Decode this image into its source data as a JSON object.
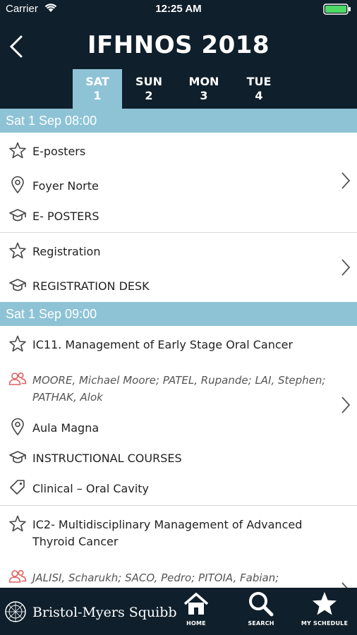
{
  "status": {
    "carrier": "Carrier",
    "time": "12:25 AM"
  },
  "header": {
    "title": "IFHNOS 2018"
  },
  "tabs": [
    {
      "day": "SAT",
      "num": "1",
      "active": true
    },
    {
      "day": "SUN",
      "num": "2",
      "active": false
    },
    {
      "day": "MON",
      "num": "3",
      "active": false
    },
    {
      "day": "TUE",
      "num": "4",
      "active": false
    }
  ],
  "sections": [
    {
      "header": "Sat 1 Sep 08:00",
      "sessions": [
        {
          "title": "E-posters",
          "location": "Foyer Norte",
          "track": "E- POSTERS"
        },
        {
          "title": "Registration",
          "track": "REGISTRATION DESK"
        }
      ]
    },
    {
      "header": "Sat 1 Sep 09:00",
      "sessions": [
        {
          "title": "IC11. Management of Early Stage Oral Cancer",
          "speakers_line1": "MOORE, Michael Moore; PATEL, Rupande; LAI, Stephen;",
          "speakers_line2": "PATHAK, Alok",
          "location": "Aula Magna",
          "track": "INSTRUCTIONAL COURSES",
          "tag": "Clinical – Oral Cavity"
        },
        {
          "title_line1": "IC2- Multidisciplinary Management of Advanced",
          "title_line2": "Thyroid Cancer",
          "speakers_line1": "JALISI, Scharukh; SACO, Pedro; PITOIA, Fabian;"
        }
      ]
    }
  ],
  "bottom": {
    "brand": "Bristol-Myers Squibb",
    "home_label": "HOME",
    "search_label": "SEARCH",
    "schedule_label": "MY SCHEDULE"
  },
  "colors": {
    "dark": "#0f1f2b",
    "accent": "#8ec3d6",
    "speaker_icon": "#e06060"
  },
  "icons": {
    "favorite": "star-outline-icon",
    "location": "map-pin-icon",
    "track": "graduation-cap-icon",
    "speakers": "people-icon",
    "tag": "tag-icon",
    "chevron": "chevron-right-icon"
  }
}
